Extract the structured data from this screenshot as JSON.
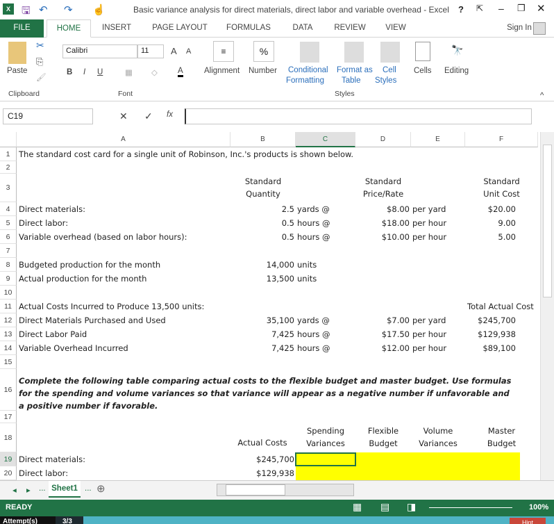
{
  "window": {
    "title": "Basic variance analysis for direct materials, direct labor and variable overhead - Excel",
    "help": "?",
    "sign_in": "Sign In"
  },
  "tabs": [
    "FILE",
    "HOME",
    "INSERT",
    "PAGE LAYOUT",
    "FORMULAS",
    "DATA",
    "REVIEW",
    "VIEW"
  ],
  "ribbon": {
    "paste": "Paste",
    "clipboard": "Clipboard",
    "font_name": "Calibri",
    "font_size": "11",
    "bold": "B",
    "italic": "I",
    "underline": "U",
    "font": "Font",
    "alignment": "Alignment",
    "number": "Number",
    "percent": "%",
    "conditional": "Conditional",
    "formatting": "Formatting",
    "format_as": "Format as",
    "table": "Table",
    "cell_styles": "Cell",
    "styles_lbl": "Styles",
    "styles": "Styles",
    "cells": "Cells",
    "editing": "Editing"
  },
  "formula_bar": {
    "name_box": "C19",
    "value": "",
    "fx": "fx"
  },
  "columns": [
    "A",
    "B",
    "C",
    "D",
    "E",
    "F"
  ],
  "rows": [
    {
      "n": "1",
      "h": 20,
      "A": "The standard cost card for a single unit of Robinson, Inc.'s products is shown below."
    },
    {
      "n": "2",
      "h": 18
    },
    {
      "n": "3",
      "h": 41,
      "B": "Standard\nQuantity",
      "D": "Standard\nPrice/Rate",
      "F": "Standard\nUnit Cost"
    },
    {
      "n": "4",
      "h": 20,
      "A": "Direct materials:",
      "B": "2.5",
      "Bu": "yards @",
      "D": "$8.00",
      "E": "per yard",
      "F": "$20.00"
    },
    {
      "n": "5",
      "h": 20,
      "A": "Direct labor:",
      "B": "0.5",
      "Bu": "hours @",
      "D": "$18.00",
      "E": "per hour",
      "F": "9.00"
    },
    {
      "n": "6",
      "h": 20,
      "A": "Variable overhead (based on labor hours):",
      "B": "0.5",
      "Bu": "hours @",
      "D": "$10.00",
      "E": "per hour",
      "F": "5.00"
    },
    {
      "n": "7",
      "h": 20
    },
    {
      "n": "8",
      "h": 20,
      "A": "Budgeted production for the month",
      "B": "14,000",
      "Bu": "units"
    },
    {
      "n": "9",
      "h": 20,
      "A": "Actual production for the month",
      "B": "13,500",
      "Bu": "units"
    },
    {
      "n": "10",
      "h": 20
    },
    {
      "n": "11",
      "h": 20,
      "A": "Actual Costs Incurred to Produce 13,500 units:",
      "F": "Total Actual Cost"
    },
    {
      "n": "12",
      "h": 20,
      "A": "Direct Materials Purchased and Used",
      "B": "35,100",
      "Bu": "yards @",
      "D": "$7.00",
      "E": "per yard",
      "F": "$245,700"
    },
    {
      "n": "13",
      "h": 20,
      "A": "Direct Labor Paid",
      "B": "7,425",
      "Bu": "hours @",
      "D": "$17.50",
      "E": "per hour",
      "F": "$129,938"
    },
    {
      "n": "14",
      "h": 20,
      "A": "Variable Overhead Incurred",
      "B": "7,425",
      "Bu": "hours @",
      "D": "$12.00",
      "E": "per hour",
      "F": "$89,100"
    },
    {
      "n": "15",
      "h": 20
    },
    {
      "n": "16",
      "h": 60,
      "A": "Complete the following table comparing actual costs to the flexible budget and master budget.  Use formulas for the spending and volume variances so that variance will appear as a negative number if unfavorable and a positive number if favorable."
    },
    {
      "n": "17",
      "h": 18
    },
    {
      "n": "18",
      "h": 42,
      "B": "Actual Costs",
      "C": "Spending\nVariances",
      "D": "Flexible\nBudget",
      "E": "Volume\nVariances",
      "F": "Master\nBudget"
    },
    {
      "n": "19",
      "h": 20,
      "A": "Direct materials:",
      "B": "$245,700"
    },
    {
      "n": "20",
      "h": 20,
      "A": "Direct labor:",
      "B": "$129,938"
    }
  ],
  "sheet_tabs": {
    "active": "Sheet1",
    "more": "..."
  },
  "status": {
    "ready": "READY",
    "zoom": "100%"
  },
  "attempts": {
    "label": "Attempt(s)",
    "value": "3/3",
    "hint": "Hint"
  },
  "colors": {
    "excel_green": "#217346",
    "yellow": "#ffff00",
    "selection": "#217346"
  }
}
